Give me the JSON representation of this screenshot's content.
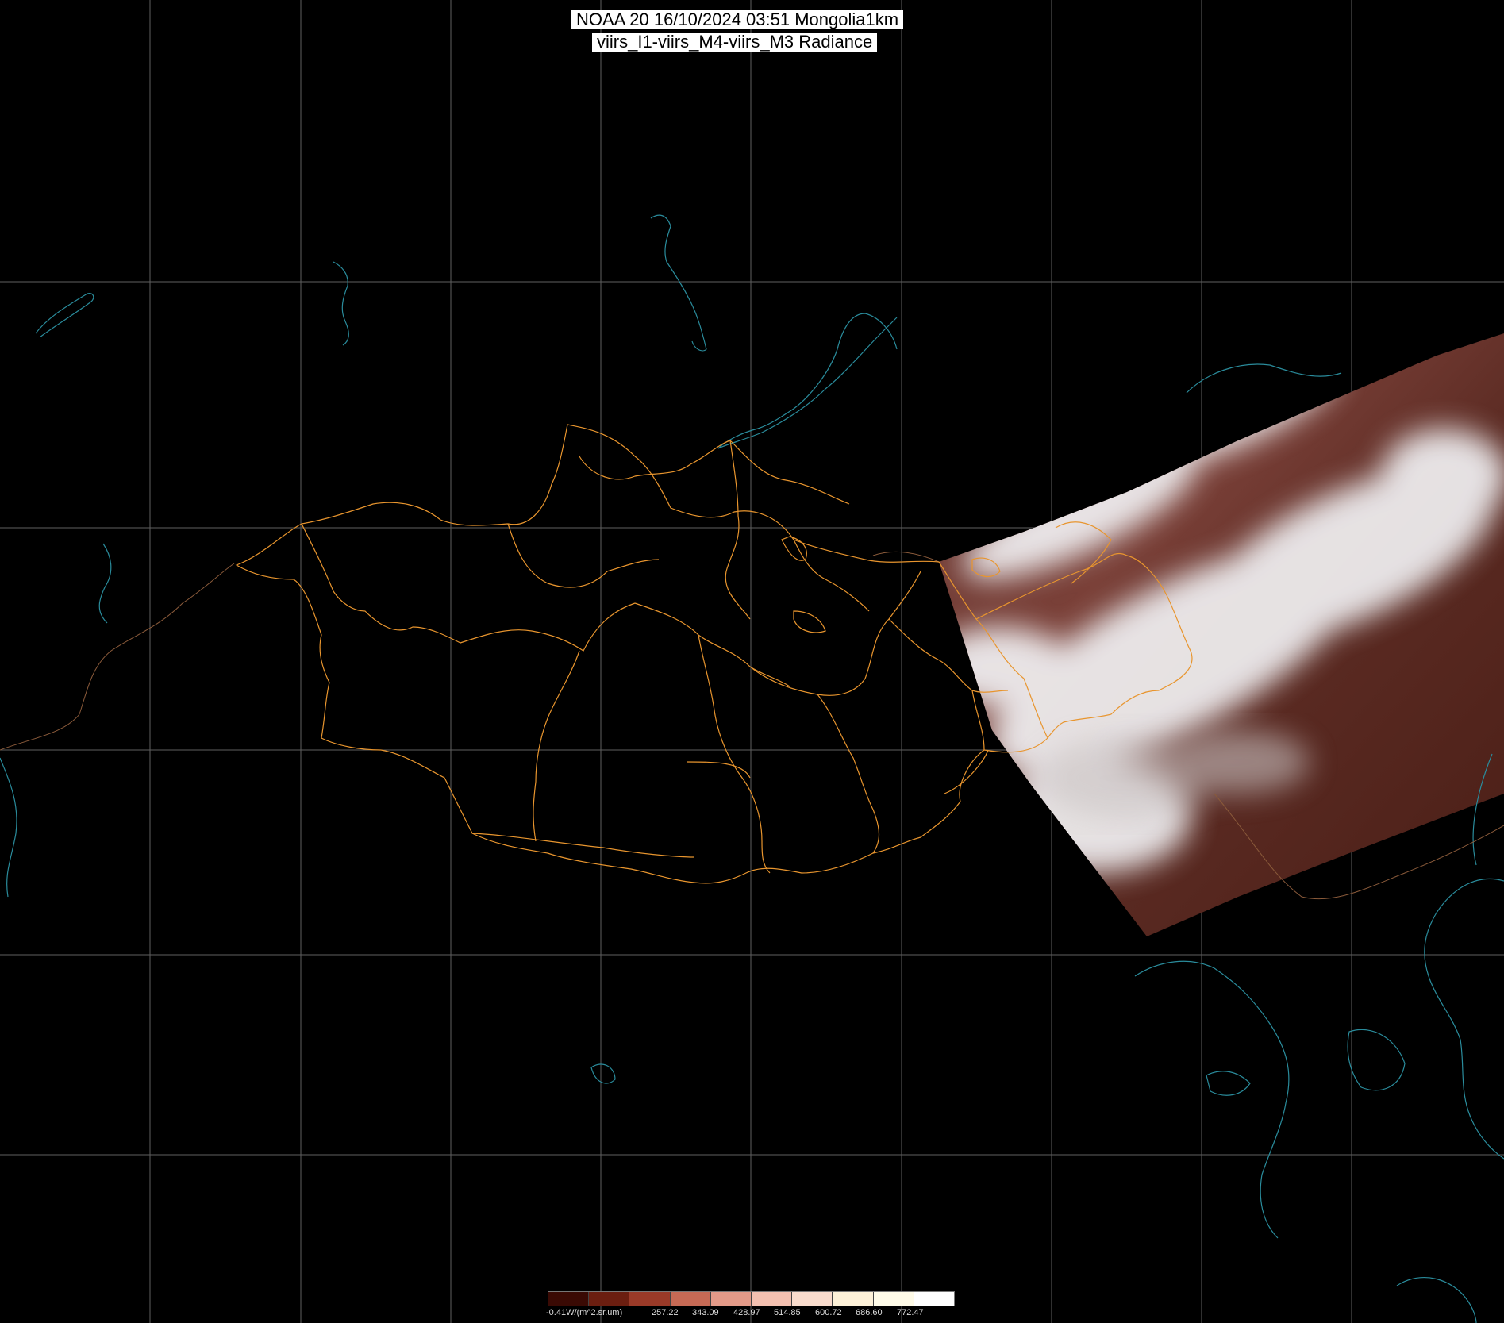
{
  "title": {
    "line1": "NOAA 20 16/10/2024 03:51 Mongolia1km",
    "line2": "viirs_I1-viirs_M4-viirs_M3 Radiance"
  },
  "colors": {
    "background": "#000000",
    "graticule": "#5f5f5f",
    "coastline": "#2a8c9c",
    "mongolia_borders": "#e8952e",
    "country_borders": "#8a5a3a"
  },
  "legend": {
    "unit_label": "-0.41W/(m^2.sr.um)",
    "tick_labels": [
      "257.22",
      "343.09",
      "428.97",
      "514.85",
      "600.72",
      "686.60",
      "772.47"
    ],
    "swatches": [
      "#3a0a04",
      "#6b1e10",
      "#9a3a28",
      "#c66a55",
      "#e39a88",
      "#f3c0b0",
      "#f9dccd",
      "#fdf1d8",
      "#fffbe8",
      "#ffffff"
    ]
  }
}
